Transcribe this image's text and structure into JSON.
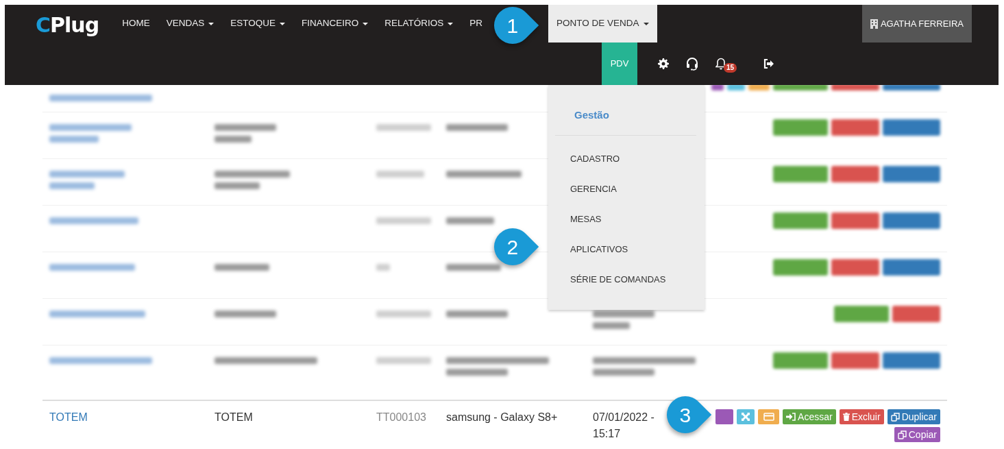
{
  "navbar": {
    "logo_text": "CPlug",
    "menu": [
      {
        "label": "HOME",
        "dropdown": false,
        "selected": false
      },
      {
        "label": "VENDAS",
        "dropdown": true,
        "selected": false
      },
      {
        "label": "ESTOQUE",
        "dropdown": true,
        "selected": false
      },
      {
        "label": "FINANCEIRO",
        "dropdown": true,
        "selected": false
      },
      {
        "label": "RELATÓRIOS",
        "dropdown": true,
        "selected": false
      },
      {
        "label": "PR",
        "dropdown": false,
        "selected": false
      },
      {
        "label": "PONTO DE VENDA",
        "dropdown": true,
        "selected": true
      }
    ],
    "user": {
      "label": "AGATHA FERREIRA"
    },
    "toolbar": [
      {
        "kind": "pdv",
        "label": "PDV"
      },
      {
        "kind": "settings"
      },
      {
        "kind": "support"
      },
      {
        "kind": "notifications",
        "badge": "15"
      },
      {
        "kind": "logout"
      }
    ]
  },
  "dropdown": {
    "header": "Gestão",
    "items": [
      "CADASTRO",
      "GERENCIA",
      "MESAS",
      "APLICATIVOS",
      "SÉRIE DE COMANDAS"
    ]
  },
  "table": {
    "rows": [
      {
        "blurred": true,
        "clipped": true,
        "cells": [
          {
            "kind": "link",
            "wrapped": false
          }
        ],
        "actions": [
          {
            "kind": "more"
          },
          {
            "kind": "expand"
          },
          {
            "kind": "card"
          },
          {
            "kind": "access"
          },
          {
            "kind": "delete"
          },
          {
            "kind": "duplicate"
          }
        ]
      },
      {
        "blurred": true,
        "clipped": false,
        "cells": [
          {
            "kind": "link",
            "wrapped": true
          },
          {
            "kind": "text",
            "wrapped": true
          },
          {
            "kind": "muted",
            "wrapped": false
          },
          {
            "kind": "text",
            "wrapped": false
          },
          {
            "kind": "none"
          }
        ],
        "actions": [
          {
            "kind": "access"
          },
          {
            "kind": "delete"
          },
          {
            "kind": "duplicate"
          }
        ]
      },
      {
        "blurred": true,
        "clipped": false,
        "cells": [
          {
            "kind": "link",
            "wrapped": true
          },
          {
            "kind": "text",
            "wrapped": true
          },
          {
            "kind": "muted",
            "wrapped": false
          },
          {
            "kind": "text",
            "wrapped": false
          },
          {
            "kind": "none"
          }
        ],
        "actions": [
          {
            "kind": "access"
          },
          {
            "kind": "delete"
          },
          {
            "kind": "duplicate"
          }
        ]
      },
      {
        "blurred": true,
        "clipped": false,
        "cells": [
          {
            "kind": "link",
            "wrapped": false
          },
          {
            "kind": "none"
          },
          {
            "kind": "muted",
            "wrapped": false
          },
          {
            "kind": "text",
            "wrapped": false
          },
          {
            "kind": "none"
          }
        ],
        "actions": [
          {
            "kind": "access"
          },
          {
            "kind": "delete"
          },
          {
            "kind": "duplicate"
          }
        ]
      },
      {
        "blurred": true,
        "clipped": false,
        "cells": [
          {
            "kind": "link",
            "wrapped": false
          },
          {
            "kind": "text",
            "wrapped": false
          },
          {
            "kind": "muted",
            "wrapped": false
          },
          {
            "kind": "text",
            "wrapped": false
          },
          {
            "kind": "none"
          }
        ],
        "actions": [
          {
            "kind": "access"
          },
          {
            "kind": "delete"
          },
          {
            "kind": "duplicate"
          }
        ]
      },
      {
        "blurred": true,
        "clipped": false,
        "cells": [
          {
            "kind": "link",
            "wrapped": false
          },
          {
            "kind": "text",
            "wrapped": false
          },
          {
            "kind": "muted",
            "wrapped": false
          },
          {
            "kind": "text",
            "wrapped": false
          },
          {
            "kind": "text",
            "wrapped": true
          }
        ],
        "actions": [
          {
            "kind": "access"
          },
          {
            "kind": "delete"
          }
        ]
      },
      {
        "blurred": true,
        "clipped": false,
        "cells": [
          {
            "kind": "link",
            "wrapped": false
          },
          {
            "kind": "text",
            "wrapped": false
          },
          {
            "kind": "muted",
            "wrapped": false
          },
          {
            "kind": "text",
            "wrapped": true
          },
          {
            "kind": "text",
            "wrapped": true
          }
        ],
        "actions": [
          {
            "kind": "access"
          },
          {
            "kind": "delete"
          },
          {
            "kind": "duplicate"
          }
        ]
      },
      {
        "blurred": false,
        "clipped": false,
        "cells": [
          {
            "kind": "link",
            "text": "TOTEM"
          },
          {
            "kind": "text",
            "text": "TOTEM"
          },
          {
            "kind": "muted",
            "text": "TT000103"
          },
          {
            "kind": "text",
            "text": "samsung - Galaxy S8+"
          },
          {
            "kind": "text",
            "text": "07/01/2022 - 15:17"
          }
        ],
        "actions": [
          {
            "kind": "more"
          },
          {
            "kind": "expand"
          },
          {
            "kind": "card"
          },
          {
            "kind": "access",
            "label": "Acessar"
          },
          {
            "kind": "delete",
            "label": "Excluir"
          },
          {
            "kind": "duplicate",
            "label": "Duplicar"
          },
          {
            "kind": "copy",
            "label": "Copiar"
          }
        ]
      }
    ]
  },
  "callouts": [
    {
      "label": "1"
    },
    {
      "label": "2"
    },
    {
      "label": "3"
    }
  ]
}
